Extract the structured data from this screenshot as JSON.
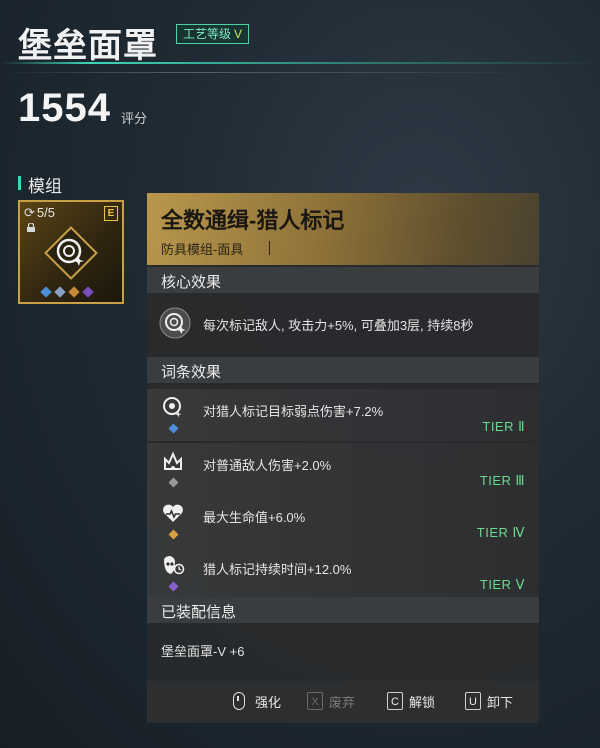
{
  "header": {
    "item_name": "堡垒面罩",
    "craft_label": "工艺等级",
    "craft_level": "V",
    "score": "1554",
    "score_label": "评分"
  },
  "module_section": {
    "title": "模组",
    "slot_count": "5/5",
    "rarity": "E",
    "gem_colors": [
      "#4a8fd8",
      "#8aa0c8",
      "#c58a3a",
      "#7a4fc0"
    ]
  },
  "card": {
    "name": "全数通缉-猎人标记",
    "subtitle": "防具模组-面具",
    "core_title": "核心效果",
    "core_text": "每次标记敌人, 攻击力+5%, 可叠加3层, 持续8秒",
    "affix_title": "词条效果",
    "affixes": [
      {
        "text": "对猎人标记目标弱点伤害+7.2%",
        "tier": "TIER Ⅱ",
        "gem_color": "#4a8fd8",
        "icon": "target-mark-icon"
      },
      {
        "text": "对普通敌人伤害+2.0%",
        "tier": "TIER Ⅲ",
        "gem_color": "#9a9a9a",
        "icon": "flame-crown-icon"
      },
      {
        "text": "最大生命值+6.0%",
        "tier": "TIER Ⅳ",
        "gem_color": "#d8a040",
        "icon": "heart-pulse-icon"
      },
      {
        "text": "猎人标记持续时间+12.0%",
        "tier": "TIER Ⅴ",
        "gem_color": "#8a5fd0",
        "icon": "mask-clock-icon"
      }
    ],
    "equip_title": "已装配信息",
    "equip_text": "堡垒面罩-V +6"
  },
  "footer": {
    "enhance": "强化",
    "discard_key": "X",
    "discard": "废弃",
    "unlock_key": "C",
    "unlock": "解锁",
    "unequip_key": "U",
    "unequip": "卸下"
  },
  "colors": {
    "accent": "#3dd6b8",
    "tier": "#6cd98f",
    "gold": "#b9974c"
  }
}
